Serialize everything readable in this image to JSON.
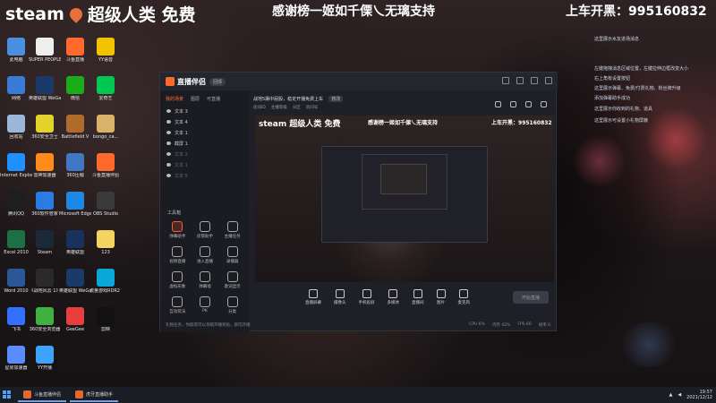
{
  "overlay": {
    "left_text": "steam",
    "left_title": "超级人类 免费",
    "center_text": "感谢榜一姬如千傈乀无璃支持",
    "right_label": "上车开黑：",
    "right_number": "995160832"
  },
  "desktop_icons": [
    {
      "label": "此电脑",
      "color": "#4a8fe0"
    },
    {
      "label": "SUPER PEOPLE CBT",
      "color": "#eeeeee"
    },
    {
      "label": "斗鱼直播",
      "color": "#ff6a2c"
    },
    {
      "label": "YY语音",
      "color": "#f2c200"
    },
    {
      "label": "网络",
      "color": "#3a7bd5"
    },
    {
      "label": "英雄联盟 WeGame版",
      "color": "#1a3a6a"
    },
    {
      "label": "微信",
      "color": "#1aad19"
    },
    {
      "label": "爱奇艺",
      "color": "#00c853"
    },
    {
      "label": "回收站",
      "color": "#9bb8d8"
    },
    {
      "label": "360安全卫士",
      "color": "#e3d32a"
    },
    {
      "label": "Battlefield V",
      "color": "#b06b2a"
    },
    {
      "label": "bongo_ca...",
      "color": "#d9b26a"
    },
    {
      "label": "Internet Explorer",
      "color": "#1e90ff"
    },
    {
      "label": "雷神加速器",
      "color": "#ff8c1a"
    },
    {
      "label": "360压缩",
      "color": "#3f77c5"
    },
    {
      "label": "斗鱼直播伴侣",
      "color": "#ff6a2c"
    },
    {
      "label": "腾讯QQ",
      "color": "#1e1e1e"
    },
    {
      "label": "360软件管家",
      "color": "#2a7be4"
    },
    {
      "label": "Microsoft Edge",
      "color": "#1e88e5"
    },
    {
      "label": "OBS Studio",
      "color": "#3a3a3a"
    },
    {
      "label": "Excel 2010",
      "color": "#1d7044"
    },
    {
      "label": "Steam",
      "color": "#1b2838"
    },
    {
      "label": "英雄联盟",
      "color": "#18325e"
    },
    {
      "label": "123",
      "color": "#f4d35e"
    },
    {
      "label": "Word 2010",
      "color": "#2b5797"
    },
    {
      "label": "《战地风云 1》",
      "color": "#2a2a2a"
    },
    {
      "label": "英雄联盟 WeGame版",
      "color": "#1a3a6a"
    },
    {
      "label": "流量游戏RDR2 WeGame版",
      "color": "#0ba7d9"
    },
    {
      "label": "飞书",
      "color": "#3370ff"
    },
    {
      "label": "360安全浏览器",
      "color": "#40b040"
    },
    {
      "label": "GeeGee",
      "color": "#e83e3e"
    },
    {
      "label": "剪映",
      "color": "#111111"
    },
    {
      "label": "星际加速器",
      "color": "#5b8cff"
    },
    {
      "label": "YY开播",
      "color": "#3da3ff"
    }
  ],
  "side_notes": [
    "这里展示水友进场消息",
    "左键拖拽消息区域位置，左键拉伸边框改变大小",
    "右上角有设置按钮",
    "这里展示弹幕、免费/付费礼物、粉丝牌升级",
    "添加弹幕助手成功",
    "这里展示你收到的礼物、道具",
    "这里展示可设置小礼物屏蔽"
  ],
  "app": {
    "title": "直播伴侣",
    "badge": "回馈",
    "tabs": [
      "我的场景",
      "图层",
      "可直播"
    ],
    "scenes": [
      {
        "label": "文本 3",
        "dim": false
      },
      {
        "label": "文本 4",
        "dim": false
      },
      {
        "label": "文本 1",
        "dim": false
      },
      {
        "label": "截屏 1",
        "dim": false
      },
      {
        "label": "文本 2",
        "dim": true
      },
      {
        "label": "文本 1",
        "dim": true
      },
      {
        "label": "文本 5",
        "dim": true
      }
    ],
    "tools_title": "工具箱",
    "tools": [
      {
        "label": "弹幕助手",
        "accent": true
      },
      {
        "label": "房管助手",
        "accent": false
      },
      {
        "label": "主播任务",
        "accent": false
      },
      {
        "label": "视频直播",
        "accent": false
      },
      {
        "label": "进入直播",
        "accent": false
      },
      {
        "label": "录播器",
        "accent": false
      },
      {
        "label": "虚拟形象",
        "accent": false
      },
      {
        "label": "弹幕墙",
        "accent": false
      },
      {
        "label": "歌词显示",
        "accent": false
      },
      {
        "label": "互动玩法",
        "accent": false
      },
      {
        "label": "PK",
        "accent": false
      },
      {
        "label": "分类",
        "accent": false
      }
    ],
    "top_bar": {
      "title": "战地5屠中屁股，稳定开播免费上车",
      "chip": "修改",
      "sub": [
        "房间ID",
        "主播等级",
        "分区",
        "房间号"
      ]
    },
    "preview": {
      "left": "steam",
      "left_title": "超级人类 免费",
      "center": "感谢榜一姬如千傈乀无璃支持",
      "right_label": "上车开黑：",
      "right_number": "995160832"
    },
    "controls": [
      "直播屏幕",
      "摄像头",
      "手机投屏",
      "多媒体",
      "直播间",
      "图片",
      "麦克风"
    ],
    "live_button": "开始直播",
    "status_left": "礼物任务，你取得可以领取开播奖励，即可开播",
    "stats": [
      "CPU 6%",
      "内存 42%",
      "FPS 60",
      "帧率 0"
    ]
  },
  "taskbar": {
    "items": [
      "斗鱼直播伴侣",
      "虎牙直播助手"
    ],
    "time": "19:57",
    "date": "2021/12/12"
  }
}
